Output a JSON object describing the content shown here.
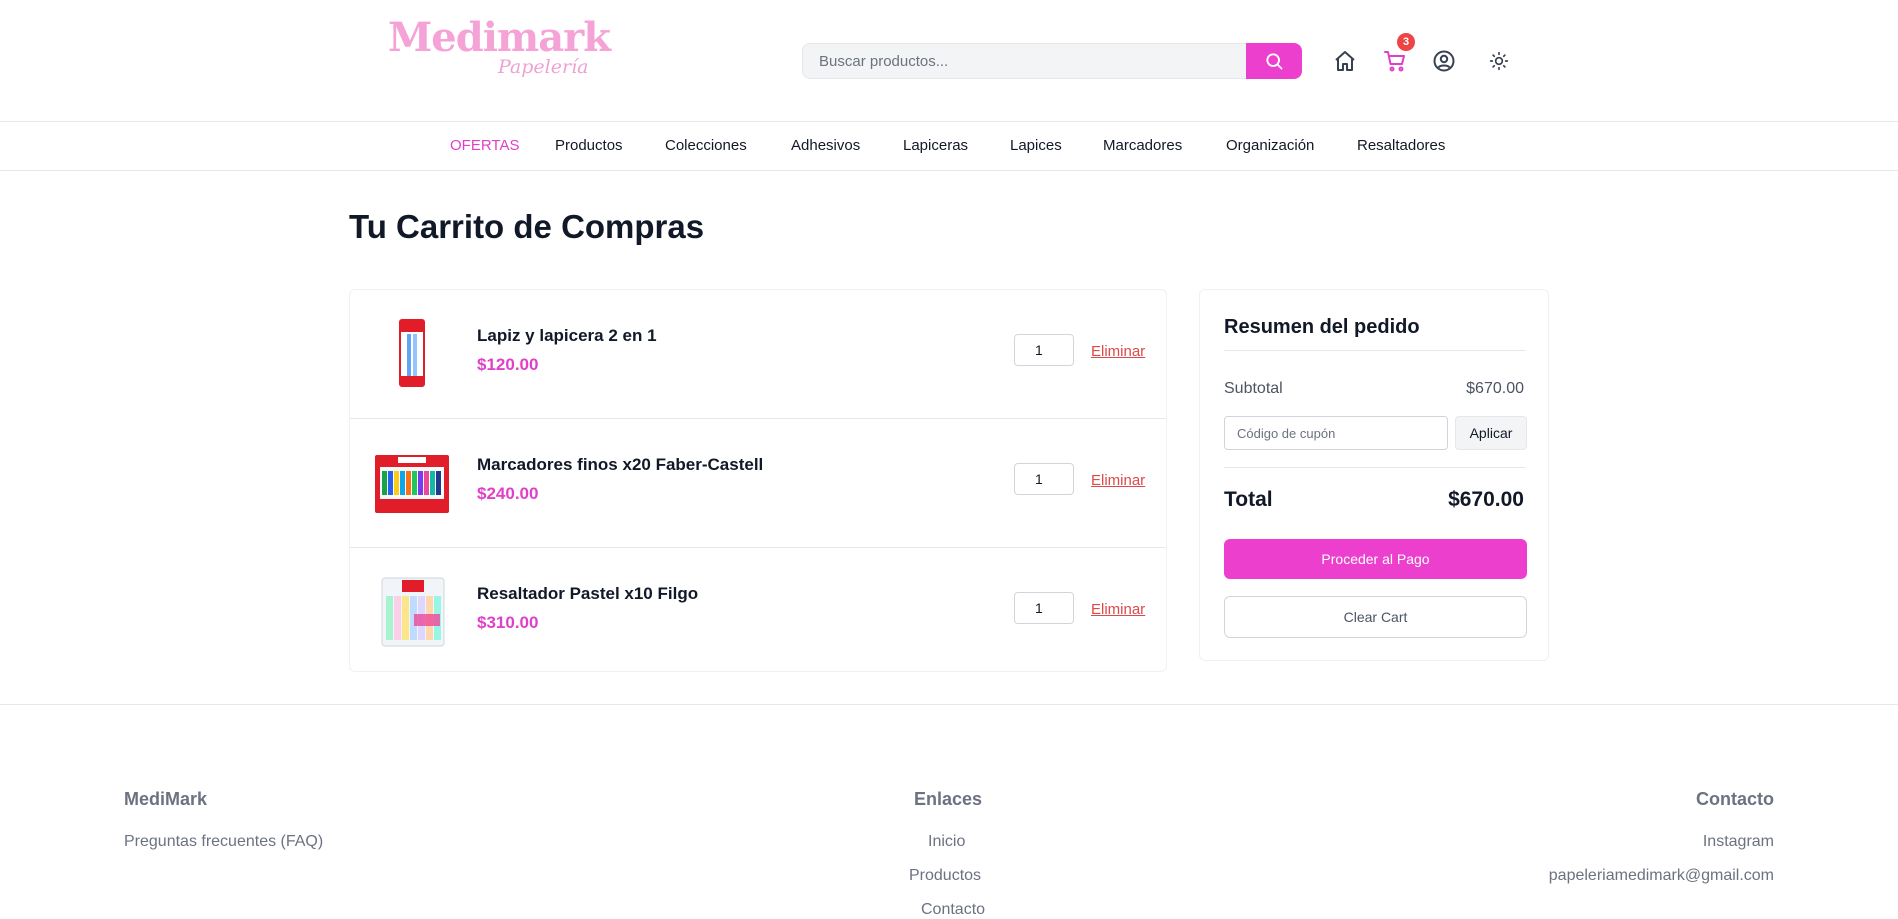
{
  "brand": {
    "name": "Medimark",
    "subtitle": "Papelería",
    "color": "#f5a3d6"
  },
  "search": {
    "placeholder": "Buscar productos...",
    "button_icon": "search-icon"
  },
  "header_icons": {
    "home": "home-icon",
    "cart": "cart-icon",
    "cart_count": "3",
    "account": "user-circle-icon",
    "theme": "sun-icon"
  },
  "nav": {
    "items": [
      {
        "label": "OFERTAS",
        "active": true
      },
      {
        "label": "Productos"
      },
      {
        "label": "Colecciones"
      },
      {
        "label": "Adhesivos"
      },
      {
        "label": "Lapiceras"
      },
      {
        "label": "Lapices"
      },
      {
        "label": "Marcadores"
      },
      {
        "label": "Organización"
      },
      {
        "label": "Resaltadores"
      }
    ]
  },
  "page": {
    "title": "Tu Carrito de Compras"
  },
  "cart": {
    "remove_label": "Eliminar",
    "items": [
      {
        "name": "Lapiz y lapicera 2 en 1",
        "price": "$120.00",
        "qty": "1"
      },
      {
        "name": "Marcadores finos x20 Faber-Castell",
        "price": "$240.00",
        "qty": "1"
      },
      {
        "name": "Resaltador Pastel x10 Filgo",
        "price": "$310.00",
        "qty": "1"
      }
    ]
  },
  "summary": {
    "title": "Resumen del pedido",
    "subtotal_label": "Subtotal",
    "subtotal_value": "$670.00",
    "coupon_placeholder": "Código de cupón",
    "apply_label": "Aplicar",
    "total_label": "Total",
    "total_value": "$670.00",
    "pay_label": "Proceder al Pago",
    "clear_label": "Clear Cart"
  },
  "footer": {
    "col1": {
      "heading": "MediMark",
      "links": [
        "Preguntas frecuentes (FAQ)"
      ]
    },
    "col2": {
      "heading": "Enlaces",
      "links": [
        "Inicio",
        "Productos",
        "Contacto"
      ]
    },
    "col3": {
      "heading": "Contacto",
      "links": [
        "Instagram",
        "papeleriamedimark@gmail.com"
      ]
    }
  },
  "colors": {
    "accent": "#ec3fce",
    "accent_text": "#e040c8",
    "remove": "#dc4a4a",
    "badge": "#ef4444"
  }
}
